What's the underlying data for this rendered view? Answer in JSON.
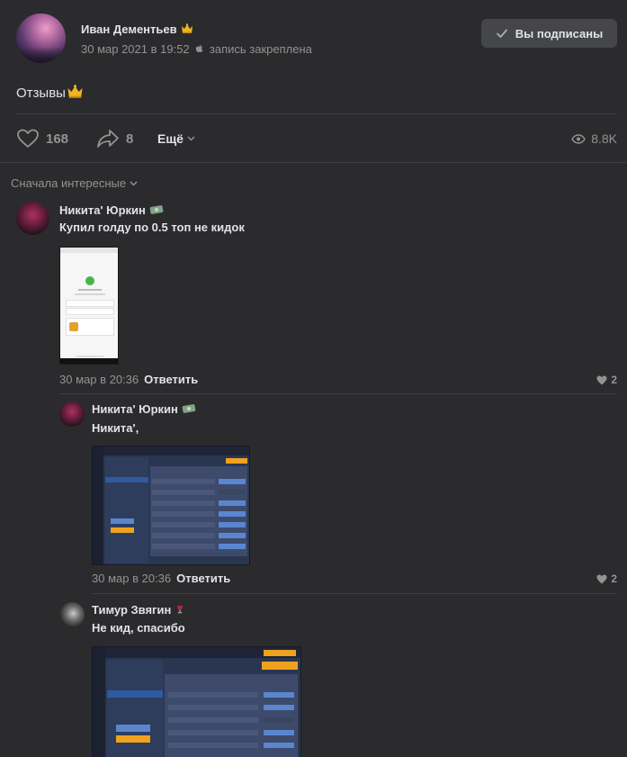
{
  "post": {
    "author": "Иван Дементьев",
    "date": "30 мар 2021 в 19:52",
    "pinned_label": "запись закреплена",
    "subscribe_label": "Вы подписаны",
    "text": "Отзывы",
    "likes": "168",
    "shares": "8",
    "more_label": "Ещё",
    "views": "8.8K"
  },
  "comments_section": {
    "sort_label": "Сначала интересные"
  },
  "comments": [
    {
      "author": "Никита' Юркин",
      "text": "Купил голду по 0.5 топ не кидок",
      "date": "30 мар в 20:36",
      "reply_label": "Ответить",
      "likes": "2"
    },
    {
      "author": "Никита' Юркин",
      "text": "Никита',",
      "date": "30 мар в 20:36",
      "reply_label": "Ответить",
      "likes": "2"
    },
    {
      "author": "Тимур Звягин",
      "text": "Не кид, спасибо"
    }
  ],
  "icons": {
    "crown": "crown-icon",
    "apple": "apple-icon",
    "check": "check-icon",
    "heart": "heart-icon",
    "share": "share-icon",
    "eye": "eye-icon",
    "chevron": "chevron-down-icon",
    "money_badge": "money-badge-icon",
    "wine": "wine-glass-icon"
  },
  "colors": {
    "background": "#2b2b2d",
    "text_primary": "#e1e3e6",
    "text_secondary": "#939393",
    "button_bg": "#454647"
  }
}
